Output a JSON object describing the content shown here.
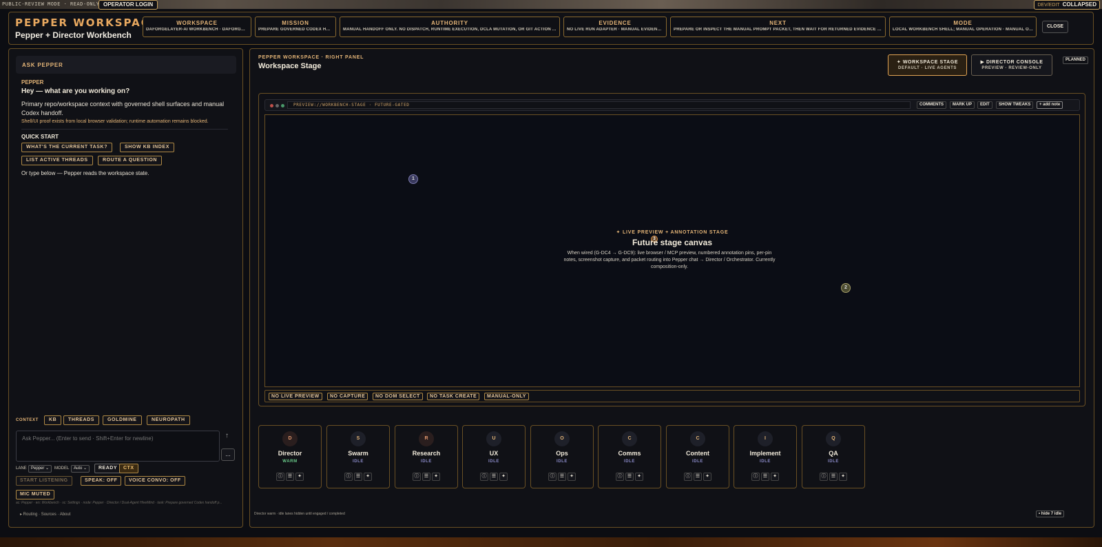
{
  "topbar": {
    "mode_text": "PUBLIC-REVIEW MODE · READ-ONLY",
    "login_label": "OPERATOR LOGIN",
    "devedit_label": "DEV/EDIT",
    "devedit_state": "COLLAPSED"
  },
  "brand": {
    "title": "PEPPER WORKSPACE",
    "subtitle": "Pepper + Director Workbench"
  },
  "chips": [
    {
      "key": "WORKSPACE",
      "value": "DAFORGELAYER-AI WORKBENCH · DAFORGELA..."
    },
    {
      "key": "MISSION",
      "value": "PREPARE GOVERNED CODEX HAN..."
    },
    {
      "key": "AUTHORITY",
      "value": "MANUAL HANDOFF ONLY. NO DISPATCH, RUNTIME EXECUTION, DCLA MUTATION, OR GIT ACTION A..."
    },
    {
      "key": "EVIDENCE",
      "value": "NO LIVE RUN ADAPTER · MANUAL EVIDENCE..."
    },
    {
      "key": "NEXT",
      "value": "PREPARE OR INSPECT THE MANUAL PROMPT PACKET, THEN WAIT FOR RETURNED EVIDENCE BEFOR..."
    },
    {
      "key": "MODE",
      "value": "LOCAL WORKBENCH SHELL; MANUAL OPERATION · MANUAL OPE..."
    }
  ],
  "close_label": "CLOSE",
  "left": {
    "ask_title": "ASK PEPPER",
    "speaker": "PEPPER",
    "greeting": "Hey — what are you working on?",
    "description": "Primary repo/workspace context with governed shell surfaces and manual Codex handoff.",
    "note": "Shell/UI proof exists from local browser validation; runtime automation remains blocked.",
    "quick_start_title": "QUICK START",
    "quick_start": [
      "WHAT'S THE CURRENT TASK?",
      "SHOW KB INDEX",
      "LIST ACTIVE THREADS",
      "ROUTE A QUESTION"
    ],
    "type_below": "Or type below — Pepper reads the workspace state.",
    "context_label": "CONTEXT",
    "context_pills": [
      "KB",
      "THREADS",
      "GOLDMINE",
      "NEUROPATH"
    ],
    "composer_placeholder": "Ask Pepper... (Enter to send · Shift+Enter for newline)",
    "send_glyph": "↑",
    "more_glyph": "...",
    "lane_label": "LANE",
    "lane_value": "Pepper ⌄",
    "model_label": "MODEL",
    "model_value": "Auto ⌄",
    "ready_label": "READY",
    "ctx_label": "CTX",
    "voice": [
      "START LISTENING",
      "SPEAK: OFF",
      "VOICE CONVO: OFF"
    ],
    "mic_label": "MIC MUTED",
    "footer_meta": "ac: Pepper · ws: Workbench · sc: Settings · node: Pepper · Director / Dual-Agent HiveMind · task: Prepare governed Codex handoff p...",
    "footer_links": "▸ Routing · Sources · About"
  },
  "right": {
    "kicker": "PEPPER WORKSPACE · RIGHT PANEL",
    "title": "Workspace Stage",
    "tabs": [
      {
        "key": "✦ WORKSPACE STAGE",
        "value": "DEFAULT · LIVE AGENTS"
      },
      {
        "key": "▶ DIRECTOR CONSOLE",
        "value": "PREVIEW · REVIEW-ONLY"
      }
    ],
    "planned_label": "PLANNED",
    "url": "PREVIEW://WORKBENCH-STAGE · FUTURE-GATED",
    "url_buttons": [
      "COMMENTS",
      "MARK UP",
      "EDIT",
      "SHOW TWEAKS",
      "+ add note"
    ],
    "pins": [
      "1",
      "2",
      "3"
    ],
    "canvas_kicker": "✦ LIVE PREVIEW + ANNOTATION STAGE",
    "canvas_title": "Future stage canvas",
    "canvas_desc": "When wired (G-DC4 → G-DC9): live browser / MCP preview, numbered annotation pins, per-pin notes, screenshot capture, and packet routing into Pepper chat → Director / Orchestrator. Currently composition-only.",
    "no_badges": [
      "NO LIVE PREVIEW",
      "NO CAPTURE",
      "NO DOM SELECT",
      "NO TASK CREATE",
      "MANUAL-ONLY"
    ],
    "agents": [
      {
        "initial": "D",
        "name": "Director",
        "status": "WARM"
      },
      {
        "initial": "S",
        "name": "Swarm",
        "status": "IDLE"
      },
      {
        "initial": "R",
        "name": "Research",
        "status": "IDLE"
      },
      {
        "initial": "U",
        "name": "UX",
        "status": "IDLE"
      },
      {
        "initial": "O",
        "name": "Ops",
        "status": "IDLE"
      },
      {
        "initial": "C",
        "name": "Comms",
        "status": "IDLE"
      },
      {
        "initial": "C",
        "name": "Content",
        "status": "IDLE"
      },
      {
        "initial": "I",
        "name": "Implement",
        "status": "IDLE"
      },
      {
        "initial": "Q",
        "name": "QA",
        "status": "IDLE"
      }
    ],
    "agent_icons": [
      "ⓘ",
      "☰",
      "✦"
    ],
    "bottom_note": "Director warm · idle lanes hidden until engaged / completed",
    "hide_idle_label": "• hide 7 idle"
  }
}
